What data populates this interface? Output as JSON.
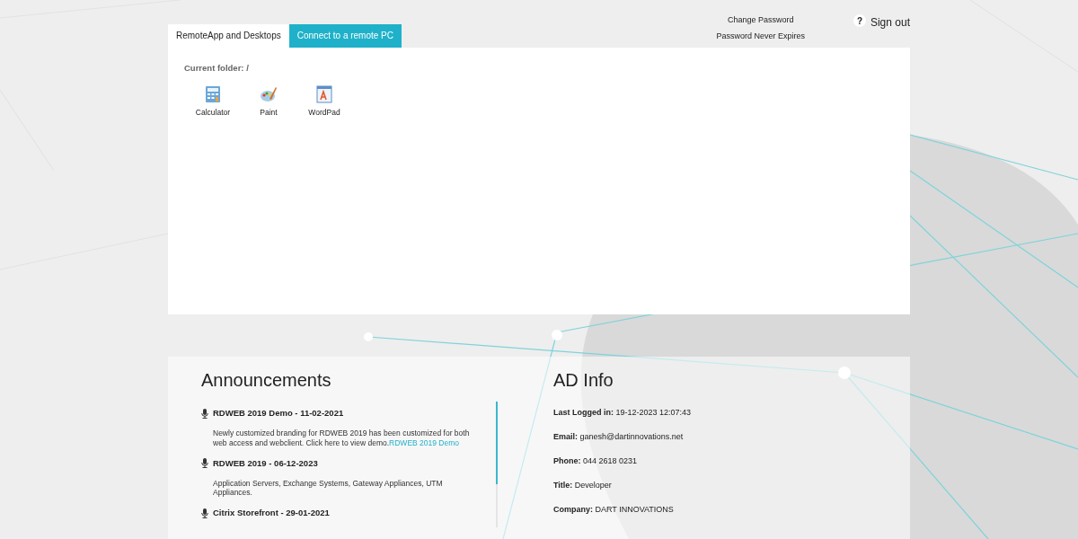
{
  "tabs": [
    {
      "label": "RemoteApp and Desktops",
      "selected": true
    },
    {
      "label": "Connect to a remote PC",
      "selected": false
    }
  ],
  "account": {
    "change_password": "Change Password",
    "password_status": "Password Never Expires",
    "help": "?",
    "sign_out": "Sign out"
  },
  "folder": {
    "label": "Current folder:",
    "path": "/"
  },
  "apps": [
    {
      "name": "Calculator",
      "kind": "calculator"
    },
    {
      "name": "Paint",
      "kind": "paint"
    },
    {
      "name": "WordPad",
      "kind": "wordpad"
    }
  ],
  "announcements": {
    "title": "Announcements",
    "items": [
      {
        "heading": "RDWEB 2019 Demo - 11-02-2021",
        "body": "Newly customized branding for RDWEB 2019 has been customized for both web access and webclient. Click here to view demo.",
        "link": "RDWEB 2019 Demo"
      },
      {
        "heading": "RDWEB 2019 - 06-12-2023",
        "body": "Application Servers, Exchange Systems, Gateway Appliances, UTM Appliances."
      },
      {
        "heading": "Citrix Storefront - 29-01-2021"
      }
    ]
  },
  "ad_info": {
    "title": "AD Info",
    "fields": [
      {
        "label": "Last Logged in:",
        "value": "19-12-2023 12:07:43"
      },
      {
        "label": "Email:",
        "value": "ganesh@dartinnovations.net"
      },
      {
        "label": "Phone:",
        "value": "044 2618 0231"
      },
      {
        "label": "Title:",
        "value": "Developer"
      },
      {
        "label": "Company:",
        "value": "DART INNOVATIONS"
      }
    ]
  }
}
